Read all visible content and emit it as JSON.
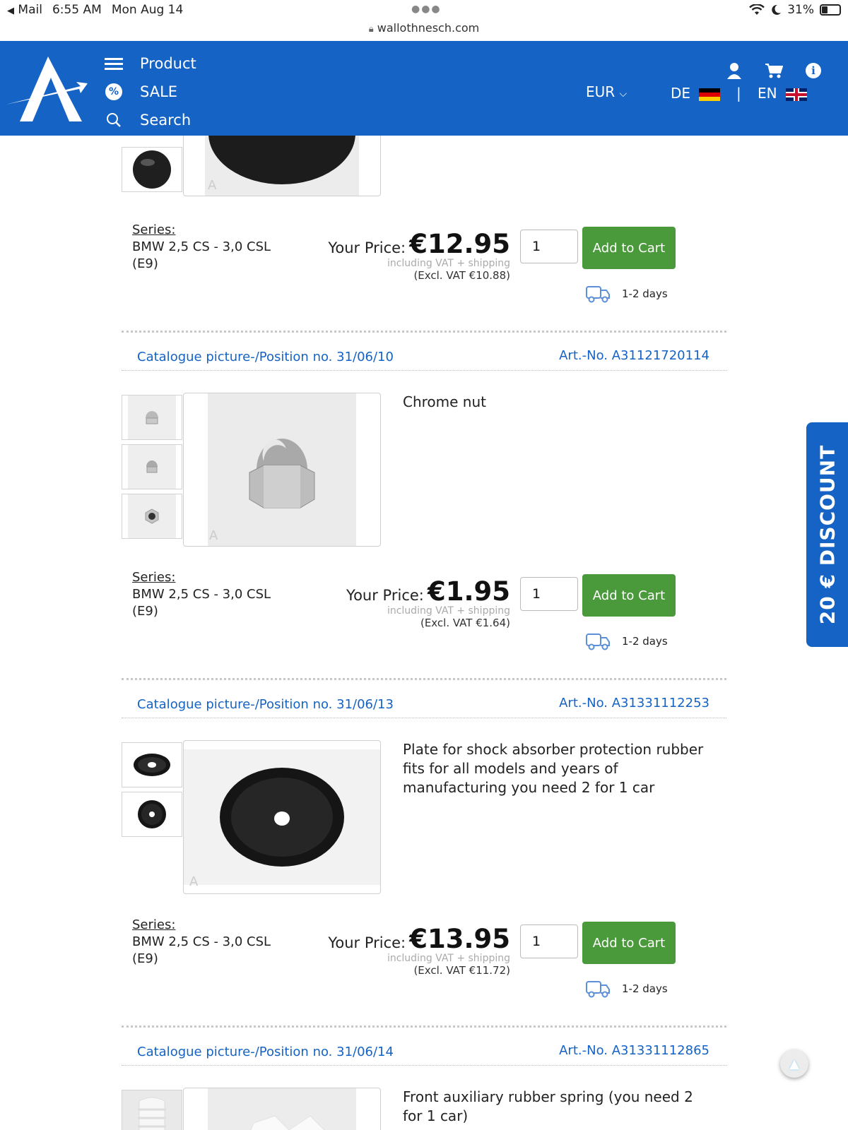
{
  "status_bar": {
    "back_app": "Mail",
    "time": "6:55 AM",
    "date": "Mon Aug 14",
    "url": "wallothnesch.com",
    "battery": "31%"
  },
  "header": {
    "nav": [
      {
        "label": "Product",
        "icon": "menu-icon"
      },
      {
        "label": "SALE",
        "icon": "percent-icon"
      },
      {
        "label": "Search",
        "icon": "search-icon"
      }
    ],
    "currency": "EUR",
    "lang_de": "DE",
    "lang_sep": "|",
    "lang_en": "EN",
    "icons": [
      "user-icon",
      "cart-icon",
      "info-icon"
    ]
  },
  "products": [
    {
      "series_label": "Series:",
      "series_line1": "BMW 2,5 CS - 3,0 CSL",
      "series_line2": "(E9)",
      "your_price_label": "Your Price:",
      "price": "€12.95",
      "vat_note": "including VAT + shipping",
      "excl_vat": "(Excl. VAT €10.88)",
      "qty": "1",
      "add_to_cart": "Add to Cart",
      "delivery": "1-2 days"
    },
    {
      "catalogue": "Catalogue picture-/Position no. 31/06/10",
      "art_no": "Art.-No. A31121720114",
      "description": "Chrome nut",
      "series_label": "Series:",
      "series_line1": "BMW 2,5 CS - 3,0 CSL",
      "series_line2": "(E9)",
      "your_price_label": "Your Price:",
      "price": "€1.95",
      "vat_note": "including VAT + shipping",
      "excl_vat": "(Excl. VAT €1.64)",
      "qty": "1",
      "add_to_cart": "Add to Cart",
      "delivery": "1-2 days"
    },
    {
      "catalogue": "Catalogue picture-/Position no. 31/06/13",
      "art_no": "Art.-No. A31331112253",
      "description_lines": [
        "Plate for shock absorber protection rubber",
        "fits for all models and years of",
        "manufacturing you need 2 for 1 car"
      ],
      "series_label": "Series:",
      "series_line1": "BMW 2,5 CS - 3,0 CSL",
      "series_line2": "(E9)",
      "your_price_label": "Your Price:",
      "price": "€13.95",
      "vat_note": "including VAT + shipping",
      "excl_vat": "(Excl. VAT €11.72)",
      "qty": "1",
      "add_to_cart": "Add to Cart",
      "delivery": "1-2 days"
    },
    {
      "catalogue": "Catalogue picture-/Position no. 31/06/14",
      "art_no": "Art.-No. A31331112865",
      "description_lines": [
        "Front auxiliary rubber spring (you need 2",
        "for 1 car)"
      ]
    }
  ],
  "discount_tab": "20 € DISCOUNT",
  "colors": {
    "brand_blue": "#1463c5",
    "cart_green": "#4a9a3c"
  }
}
